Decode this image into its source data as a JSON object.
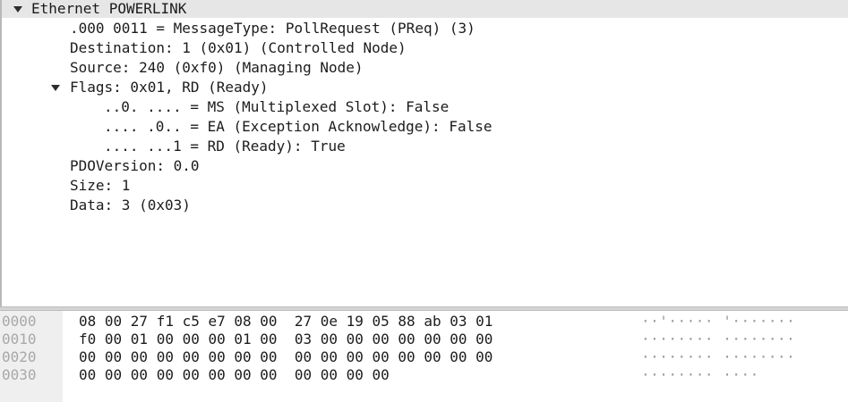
{
  "detail_tree": {
    "items": [
      {
        "text": "Ethernet POWERLINK",
        "expanded": true
      },
      {
        "text": ".000 0011 = MessageType: PollRequest (PReq) (3)"
      },
      {
        "text": "Destination: 1 (0x01) (Controlled Node)"
      },
      {
        "text": "Source: 240 (0xf0) (Managing Node)"
      },
      {
        "text": "Flags: 0x01, RD (Ready)",
        "expanded": true
      },
      {
        "text": "..0. .... = MS (Multiplexed Slot): False"
      },
      {
        "text": ".... .0.. = EA (Exception Acknowledge): False"
      },
      {
        "text": ".... ...1 = RD (Ready): True"
      },
      {
        "text": "PDOVersion: 0.0"
      },
      {
        "text": "Size: 1"
      },
      {
        "text": "Data: 3 (0x03)"
      }
    ],
    "toggle_icon": "triangle-down-icon"
  },
  "hex_dump": {
    "rows": [
      {
        "offset": "0000",
        "bytes": "08 00 27 f1 c5 e7 08 00  27 0e 19 05 88 ab 03 01",
        "ascii": "··'····· '·······"
      },
      {
        "offset": "0010",
        "bytes": "f0 00 01 00 00 00 01 00  03 00 00 00 00 00 00 00",
        "ascii": "········ ········"
      },
      {
        "offset": "0020",
        "bytes": "00 00 00 00 00 00 00 00  00 00 00 00 00 00 00 00",
        "ascii": "········ ········"
      },
      {
        "offset": "0030",
        "bytes": "00 00 00 00 00 00 00 00  00 00 00 00",
        "ascii": "········ ····"
      }
    ]
  },
  "colors": {
    "selected_row": "#e6e6e6",
    "offset_text": "#a8a8a8",
    "offset_gutter": "#efefef"
  }
}
